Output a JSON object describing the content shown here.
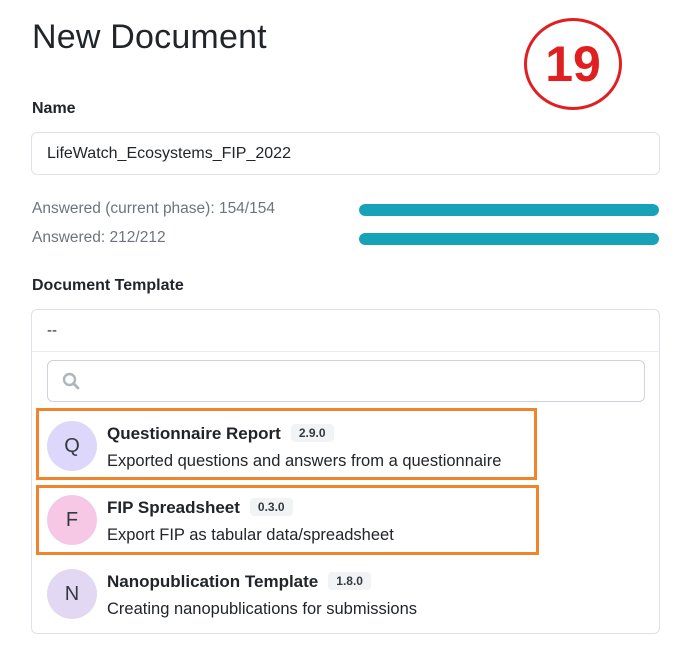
{
  "page": {
    "title": "New Document",
    "step_number": "19"
  },
  "name_field": {
    "label": "Name",
    "value": "LifeWatch_Ecosystems_FIP_2022"
  },
  "progress": [
    {
      "label": "Answered (current phase): 154/154",
      "fraction": 1.0,
      "color": "#17a2b8"
    },
    {
      "label": "Answered: 212/212",
      "fraction": 1.0,
      "color": "#17a2b8"
    }
  ],
  "template_field": {
    "label": "Document Template",
    "selected": "--",
    "search_placeholder": ""
  },
  "templates": [
    {
      "initial": "Q",
      "name": "Questionnaire Report",
      "version": "2.9.0",
      "description": "Exported questions and answers from a questionnaire",
      "avatar_color": "#ddd8fb",
      "highlighted": true
    },
    {
      "initial": "F",
      "name": "FIP Spreadsheet",
      "version": "0.3.0",
      "description": "Export FIP as tabular data/spreadsheet",
      "avatar_color": "#f7c8e6",
      "highlighted": true
    },
    {
      "initial": "N",
      "name": "Nanopublication Template",
      "version": "1.8.0",
      "description": "Creating nanopublications for submissions",
      "avatar_color": "#e3d8f3",
      "highlighted": false
    }
  ]
}
